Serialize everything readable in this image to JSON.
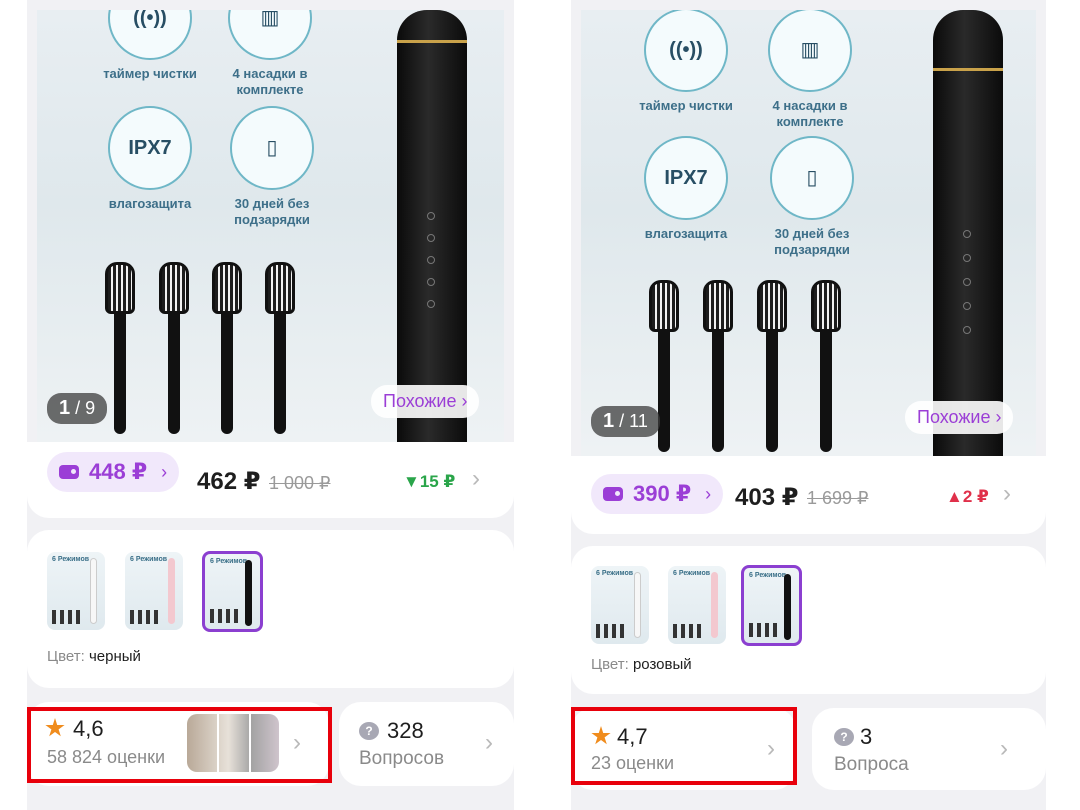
{
  "left": {
    "gallery": {
      "features": [
        "таймер чистки",
        "4 насадки в комплекте",
        "влагозащита",
        "30 дней без подзарядки"
      ],
      "ipx_label": "IPX7",
      "counter_current": "1",
      "counter_total": "9",
      "similar_label": "Похожие ›"
    },
    "price": {
      "wallet_price": "448 ₽",
      "price": "462 ₽",
      "old_price": "1 000 ₽",
      "delta": "▼15 ₽",
      "delta_color": "#2aa54a"
    },
    "color": {
      "key": "Цвет:",
      "value": "черный",
      "thumb_title": "6 Режимов"
    },
    "rating": {
      "value": "4,6",
      "count": "58 824 оценки"
    },
    "questions": {
      "count": "328",
      "label": "Вопросов"
    }
  },
  "right": {
    "gallery": {
      "features": [
        "таймер чистки",
        "4 насадки в комплекте",
        "влагозащита",
        "30 дней без подзарядки"
      ],
      "ipx_label": "IPX7",
      "counter_current": "1",
      "counter_total": "11",
      "similar_label": "Похожие ›"
    },
    "price": {
      "wallet_price": "390 ₽",
      "price": "403 ₽",
      "old_price": "1 699 ₽",
      "delta": "▲2 ₽",
      "delta_color": "#e0304a"
    },
    "color": {
      "key": "Цвет:",
      "value": "розовый",
      "thumb_title": "6 Режимов"
    },
    "rating": {
      "value": "4,7",
      "count": "23 оценки"
    },
    "questions": {
      "count": "3",
      "label": "Вопроса"
    }
  }
}
